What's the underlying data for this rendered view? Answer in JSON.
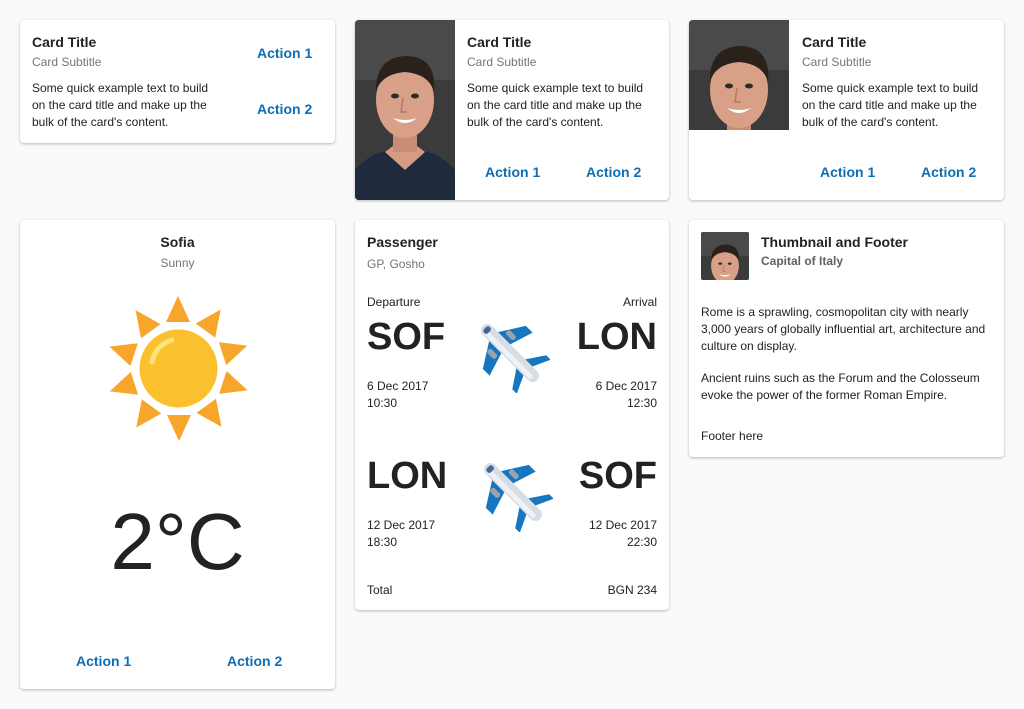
{
  "colors": {
    "accent": "#0f6db3",
    "background": "#fafafa",
    "subtitle": "#757575"
  },
  "card1": {
    "title": "Card Title",
    "subtitle": "Card Subtitle",
    "content": "Some quick example text to build on the card title and make up the bulk of the card's content.",
    "action1": "Action 1",
    "action2": "Action 2"
  },
  "card2": {
    "title": "Card Title",
    "subtitle": "Card Subtitle",
    "content": "Some quick example text to build on the card title and make up the bulk of the card's content.",
    "action1": "Action 1",
    "action2": "Action 2"
  },
  "card3": {
    "title": "Card Title",
    "subtitle": "Card Subtitle",
    "content": "Some quick example text to build on the card title and make up the bulk of the card's content.",
    "action1": "Action 1",
    "action2": "Action 2"
  },
  "weather": {
    "city": "Sofia",
    "condition": "Sunny",
    "icon": "sun-icon",
    "temperature": "2°C",
    "action1": "Action 1",
    "action2": "Action 2"
  },
  "flight": {
    "title": "Passenger",
    "subtitle": "GP, Gosho",
    "departure_label": "Departure",
    "arrival_label": "Arrival",
    "legs": [
      {
        "from": "SOF",
        "to": "LON",
        "dep_date": "6 Dec 2017",
        "dep_time": "10:30",
        "arr_date": "6 Dec 2017",
        "arr_time": "12:30"
      },
      {
        "from": "LON",
        "to": "SOF",
        "dep_date": "12 Dec 2017",
        "dep_time": "18:30",
        "arr_date": "12 Dec 2017",
        "arr_time": "22:30"
      }
    ],
    "icon": "airplane-icon",
    "total_label": "Total",
    "total_value": "BGN 234"
  },
  "thumbnail": {
    "title": "Thumbnail and Footer",
    "subtitle": "Capital of Italy",
    "paragraph1": "Rome is a sprawling, cosmopolitan city with nearly 3,000 years of globally influential art, architecture and culture on display.",
    "paragraph2": "Ancient ruins such as the Forum and the Colosseum evoke the power of the former Roman Empire.",
    "footer": "Footer here"
  }
}
